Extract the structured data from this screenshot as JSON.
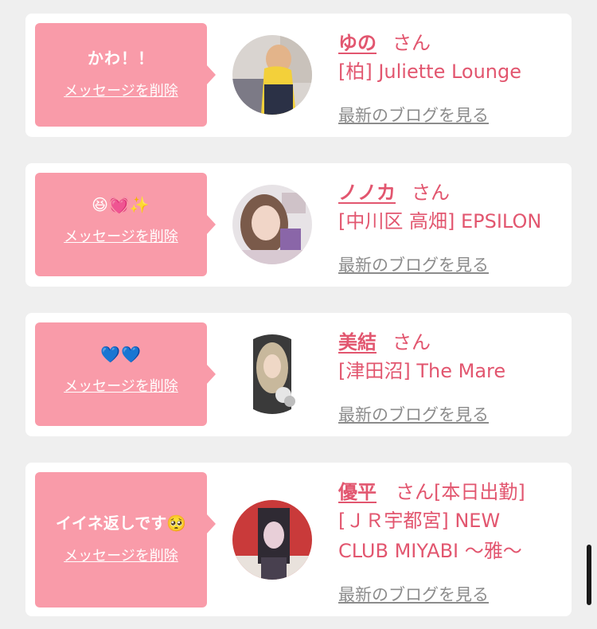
{
  "cards": [
    {
      "message": "かわ！！",
      "delete_label": "メッセージを削除",
      "name": "ゆの",
      "honorific": "さん",
      "shop": "[柏] Juliette Lounge",
      "blog_link": "最新のブログを見る"
    },
    {
      "message": "😆💓✨",
      "delete_label": "メッセージを削除",
      "name": "ノノカ",
      "honorific": "さん",
      "shop": "[中川区 高畑] EPSILON",
      "blog_link": "最新のブログを見る"
    },
    {
      "message": "💙💙",
      "delete_label": "メッセージを削除",
      "name": "美結",
      "honorific": "さん",
      "shop": "[津田沼] The Mare",
      "blog_link": "最新のブログを見る"
    },
    {
      "message": "イイネ返しです🥺",
      "delete_label": "メッセージを削除",
      "name": "優平",
      "honorific": "さん[本日出勤]",
      "shop_line1": "[ＪＲ宇都宮] NEW",
      "shop_line2": "CLUB MIYABI 〜雅〜",
      "blog_link": "最新のブログを見る"
    }
  ],
  "colors": {
    "page_bg": "#efefef",
    "card_bg": "#ffffff",
    "bubble_bg": "#f99ba9",
    "accent_text": "#e2566f",
    "link_gray": "#8c8c8c"
  }
}
